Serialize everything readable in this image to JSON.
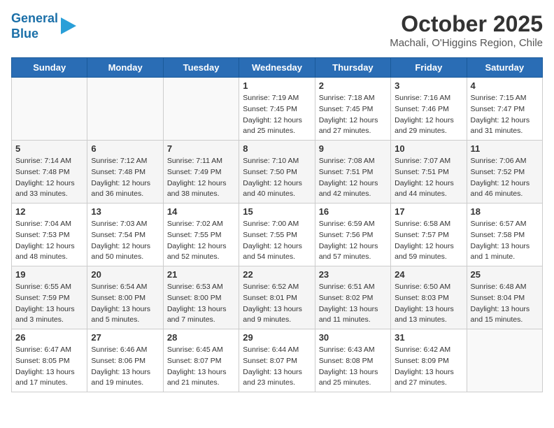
{
  "header": {
    "logo_line1": "General",
    "logo_line2": "Blue",
    "month": "October 2025",
    "location": "Machali, O'Higgins Region, Chile"
  },
  "weekdays": [
    "Sunday",
    "Monday",
    "Tuesday",
    "Wednesday",
    "Thursday",
    "Friday",
    "Saturday"
  ],
  "weeks": [
    [
      {
        "day": "",
        "sunrise": "",
        "sunset": "",
        "daylight": ""
      },
      {
        "day": "",
        "sunrise": "",
        "sunset": "",
        "daylight": ""
      },
      {
        "day": "",
        "sunrise": "",
        "sunset": "",
        "daylight": ""
      },
      {
        "day": "1",
        "sunrise": "Sunrise: 7:19 AM",
        "sunset": "Sunset: 7:45 PM",
        "daylight": "Daylight: 12 hours and 25 minutes."
      },
      {
        "day": "2",
        "sunrise": "Sunrise: 7:18 AM",
        "sunset": "Sunset: 7:45 PM",
        "daylight": "Daylight: 12 hours and 27 minutes."
      },
      {
        "day": "3",
        "sunrise": "Sunrise: 7:16 AM",
        "sunset": "Sunset: 7:46 PM",
        "daylight": "Daylight: 12 hours and 29 minutes."
      },
      {
        "day": "4",
        "sunrise": "Sunrise: 7:15 AM",
        "sunset": "Sunset: 7:47 PM",
        "daylight": "Daylight: 12 hours and 31 minutes."
      }
    ],
    [
      {
        "day": "5",
        "sunrise": "Sunrise: 7:14 AM",
        "sunset": "Sunset: 7:48 PM",
        "daylight": "Daylight: 12 hours and 33 minutes."
      },
      {
        "day": "6",
        "sunrise": "Sunrise: 7:12 AM",
        "sunset": "Sunset: 7:48 PM",
        "daylight": "Daylight: 12 hours and 36 minutes."
      },
      {
        "day": "7",
        "sunrise": "Sunrise: 7:11 AM",
        "sunset": "Sunset: 7:49 PM",
        "daylight": "Daylight: 12 hours and 38 minutes."
      },
      {
        "day": "8",
        "sunrise": "Sunrise: 7:10 AM",
        "sunset": "Sunset: 7:50 PM",
        "daylight": "Daylight: 12 hours and 40 minutes."
      },
      {
        "day": "9",
        "sunrise": "Sunrise: 7:08 AM",
        "sunset": "Sunset: 7:51 PM",
        "daylight": "Daylight: 12 hours and 42 minutes."
      },
      {
        "day": "10",
        "sunrise": "Sunrise: 7:07 AM",
        "sunset": "Sunset: 7:51 PM",
        "daylight": "Daylight: 12 hours and 44 minutes."
      },
      {
        "day": "11",
        "sunrise": "Sunrise: 7:06 AM",
        "sunset": "Sunset: 7:52 PM",
        "daylight": "Daylight: 12 hours and 46 minutes."
      }
    ],
    [
      {
        "day": "12",
        "sunrise": "Sunrise: 7:04 AM",
        "sunset": "Sunset: 7:53 PM",
        "daylight": "Daylight: 12 hours and 48 minutes."
      },
      {
        "day": "13",
        "sunrise": "Sunrise: 7:03 AM",
        "sunset": "Sunset: 7:54 PM",
        "daylight": "Daylight: 12 hours and 50 minutes."
      },
      {
        "day": "14",
        "sunrise": "Sunrise: 7:02 AM",
        "sunset": "Sunset: 7:55 PM",
        "daylight": "Daylight: 12 hours and 52 minutes."
      },
      {
        "day": "15",
        "sunrise": "Sunrise: 7:00 AM",
        "sunset": "Sunset: 7:55 PM",
        "daylight": "Daylight: 12 hours and 54 minutes."
      },
      {
        "day": "16",
        "sunrise": "Sunrise: 6:59 AM",
        "sunset": "Sunset: 7:56 PM",
        "daylight": "Daylight: 12 hours and 57 minutes."
      },
      {
        "day": "17",
        "sunrise": "Sunrise: 6:58 AM",
        "sunset": "Sunset: 7:57 PM",
        "daylight": "Daylight: 12 hours and 59 minutes."
      },
      {
        "day": "18",
        "sunrise": "Sunrise: 6:57 AM",
        "sunset": "Sunset: 7:58 PM",
        "daylight": "Daylight: 13 hours and 1 minute."
      }
    ],
    [
      {
        "day": "19",
        "sunrise": "Sunrise: 6:55 AM",
        "sunset": "Sunset: 7:59 PM",
        "daylight": "Daylight: 13 hours and 3 minutes."
      },
      {
        "day": "20",
        "sunrise": "Sunrise: 6:54 AM",
        "sunset": "Sunset: 8:00 PM",
        "daylight": "Daylight: 13 hours and 5 minutes."
      },
      {
        "day": "21",
        "sunrise": "Sunrise: 6:53 AM",
        "sunset": "Sunset: 8:00 PM",
        "daylight": "Daylight: 13 hours and 7 minutes."
      },
      {
        "day": "22",
        "sunrise": "Sunrise: 6:52 AM",
        "sunset": "Sunset: 8:01 PM",
        "daylight": "Daylight: 13 hours and 9 minutes."
      },
      {
        "day": "23",
        "sunrise": "Sunrise: 6:51 AM",
        "sunset": "Sunset: 8:02 PM",
        "daylight": "Daylight: 13 hours and 11 minutes."
      },
      {
        "day": "24",
        "sunrise": "Sunrise: 6:50 AM",
        "sunset": "Sunset: 8:03 PM",
        "daylight": "Daylight: 13 hours and 13 minutes."
      },
      {
        "day": "25",
        "sunrise": "Sunrise: 6:48 AM",
        "sunset": "Sunset: 8:04 PM",
        "daylight": "Daylight: 13 hours and 15 minutes."
      }
    ],
    [
      {
        "day": "26",
        "sunrise": "Sunrise: 6:47 AM",
        "sunset": "Sunset: 8:05 PM",
        "daylight": "Daylight: 13 hours and 17 minutes."
      },
      {
        "day": "27",
        "sunrise": "Sunrise: 6:46 AM",
        "sunset": "Sunset: 8:06 PM",
        "daylight": "Daylight: 13 hours and 19 minutes."
      },
      {
        "day": "28",
        "sunrise": "Sunrise: 6:45 AM",
        "sunset": "Sunset: 8:07 PM",
        "daylight": "Daylight: 13 hours and 21 minutes."
      },
      {
        "day": "29",
        "sunrise": "Sunrise: 6:44 AM",
        "sunset": "Sunset: 8:07 PM",
        "daylight": "Daylight: 13 hours and 23 minutes."
      },
      {
        "day": "30",
        "sunrise": "Sunrise: 6:43 AM",
        "sunset": "Sunset: 8:08 PM",
        "daylight": "Daylight: 13 hours and 25 minutes."
      },
      {
        "day": "31",
        "sunrise": "Sunrise: 6:42 AM",
        "sunset": "Sunset: 8:09 PM",
        "daylight": "Daylight: 13 hours and 27 minutes."
      },
      {
        "day": "",
        "sunrise": "",
        "sunset": "",
        "daylight": ""
      }
    ]
  ]
}
